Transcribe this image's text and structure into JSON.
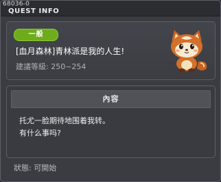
{
  "window": {
    "quest_id": "68036-0",
    "title": "QUEST INFO"
  },
  "quest": {
    "badge": "一般",
    "title": "[血月森林]青林派是我的人生!",
    "level_range": "建議等級: 250~254",
    "avatar_icon": "red-panda-npc-icon"
  },
  "content": {
    "header": "內容",
    "lines": [
      "托尤一脸期待地围着我转。",
      "有什么事吗?"
    ]
  },
  "status": {
    "text": "狀態:  可開始"
  },
  "colors": {
    "badge_green": "#6fac1c",
    "panel": "#3a3c41"
  }
}
